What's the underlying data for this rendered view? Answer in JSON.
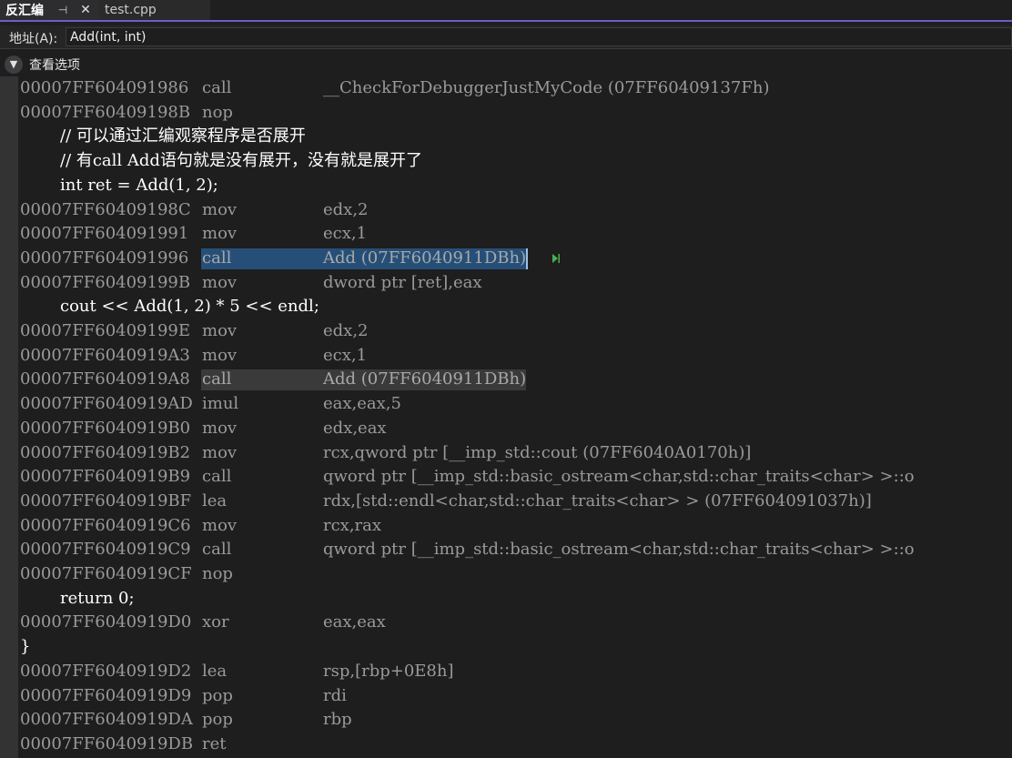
{
  "tabs": [
    {
      "label": "反汇编",
      "active": true,
      "pin_icon": "pin-icon",
      "close_icon": "close-icon"
    },
    {
      "label": "test.cpp",
      "active": false
    }
  ],
  "address": {
    "label": "地址(A):",
    "value": "Add(int, int)"
  },
  "view_options": {
    "label": "查看选项",
    "icon": "chevron-down-icon"
  },
  "lines": [
    {
      "type": "asm",
      "addr": "00007FF604091986",
      "mnemonic": "call",
      "operand": "__CheckForDebuggerJustMyCode (07FF60409137Fh)"
    },
    {
      "type": "asm",
      "addr": "00007FF60409198B",
      "mnemonic": "nop",
      "operand": ""
    },
    {
      "type": "src",
      "text": "// 可以通过汇编观察程序是否展开"
    },
    {
      "type": "src",
      "text": "// 有call Add语句就是没有展开，没有就是展开了"
    },
    {
      "type": "src",
      "text": "int ret = Add(1, 2);"
    },
    {
      "type": "asm",
      "addr": "00007FF60409198C",
      "mnemonic": "mov",
      "operand": "edx,2"
    },
    {
      "type": "asm",
      "addr": "00007FF604091991",
      "mnemonic": "mov",
      "operand": "ecx,1"
    },
    {
      "type": "asm",
      "addr": "00007FF604091996",
      "mnemonic": "call",
      "operand": "Add (07FF6040911DBh)",
      "highlight": "blue"
    },
    {
      "type": "asm",
      "addr": "00007FF60409199B",
      "mnemonic": "mov",
      "operand": "dword ptr [ret],eax"
    },
    {
      "type": "src",
      "text": "cout << Add(1, 2) * 5 << endl;"
    },
    {
      "type": "asm",
      "addr": "00007FF60409199E",
      "mnemonic": "mov",
      "operand": "edx,2"
    },
    {
      "type": "asm",
      "addr": "00007FF6040919A3",
      "mnemonic": "mov",
      "operand": "ecx,1"
    },
    {
      "type": "asm",
      "addr": "00007FF6040919A8",
      "mnemonic": "call",
      "operand": "Add (07FF6040911DBh)",
      "highlight": "gray"
    },
    {
      "type": "asm",
      "addr": "00007FF6040919AD",
      "mnemonic": "imul",
      "operand": "eax,eax,5"
    },
    {
      "type": "asm",
      "addr": "00007FF6040919B0",
      "mnemonic": "mov",
      "operand": "edx,eax"
    },
    {
      "type": "asm",
      "addr": "00007FF6040919B2",
      "mnemonic": "mov",
      "operand": "rcx,qword ptr [__imp_std::cout (07FF6040A0170h)]"
    },
    {
      "type": "asm",
      "addr": "00007FF6040919B9",
      "mnemonic": "call",
      "operand": "qword ptr [__imp_std::basic_ostream<char,std::char_traits<char> >::o"
    },
    {
      "type": "asm",
      "addr": "00007FF6040919BF",
      "mnemonic": "lea",
      "operand": "rdx,[std::endl<char,std::char_traits<char> > (07FF604091037h)]"
    },
    {
      "type": "asm",
      "addr": "00007FF6040919C6",
      "mnemonic": "mov",
      "operand": "rcx,rax"
    },
    {
      "type": "asm",
      "addr": "00007FF6040919C9",
      "mnemonic": "call",
      "operand": "qword ptr [__imp_std::basic_ostream<char,std::char_traits<char> >::o"
    },
    {
      "type": "asm",
      "addr": "00007FF6040919CF",
      "mnemonic": "nop",
      "operand": ""
    },
    {
      "type": "src",
      "text": "return 0;"
    },
    {
      "type": "asm",
      "addr": "00007FF6040919D0",
      "mnemonic": "xor",
      "operand": "eax,eax"
    },
    {
      "type": "brace",
      "text": "}"
    },
    {
      "type": "asm",
      "addr": "00007FF6040919D2",
      "mnemonic": "lea",
      "operand": "rsp,[rbp+0E8h]"
    },
    {
      "type": "asm",
      "addr": "00007FF6040919D9",
      "mnemonic": "pop",
      "operand": "rdi"
    },
    {
      "type": "asm",
      "addr": "00007FF6040919DA",
      "mnemonic": "pop",
      "operand": "rbp"
    },
    {
      "type": "asm",
      "addr": "00007FF6040919DB",
      "mnemonic": "ret",
      "operand": ""
    }
  ],
  "colors": {
    "accent": "#6b5fc7",
    "selection": "#264f78",
    "exec_arrow": "#4caf50"
  }
}
